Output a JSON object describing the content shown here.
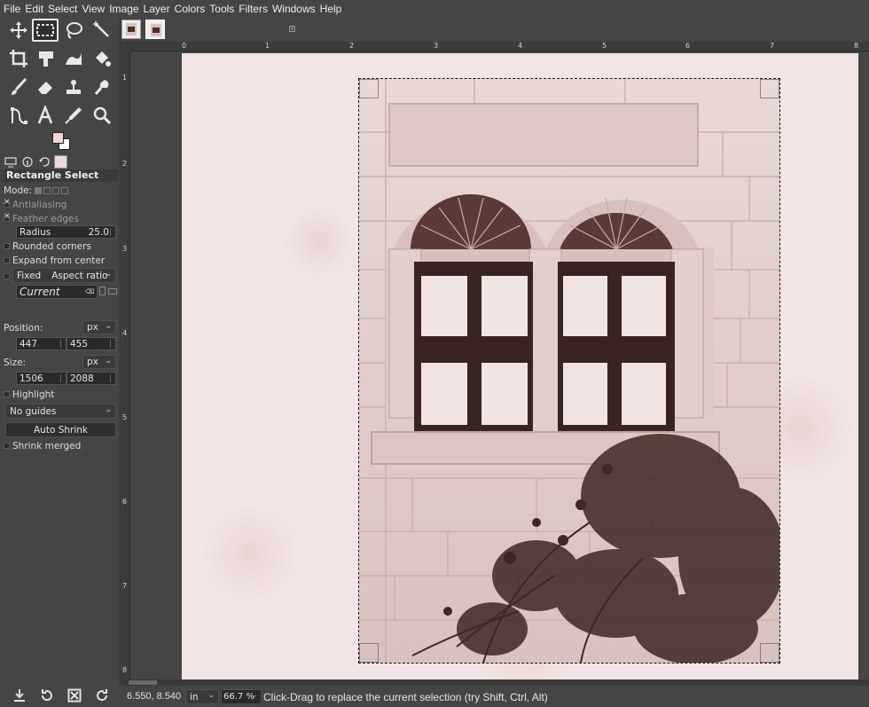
{
  "menubar": [
    "File",
    "Edit",
    "Select",
    "View",
    "Image",
    "Layer",
    "Colors",
    "Tools",
    "Filters",
    "Windows",
    "Help"
  ],
  "toolbox": {
    "tools": [
      "move-tool",
      "rectangle-select-tool",
      "free-select-tool",
      "fuzzy-select-tool",
      "crop-tool",
      "unified-transform-tool",
      "warp-transform-tool",
      "bucket-fill-tool",
      "paintbrush-tool",
      "eraser-tool",
      "clone-tool",
      "smudge-tool",
      "paths-tool",
      "text-tool",
      "color-picker-tool",
      "zoom-tool"
    ],
    "active": "rectangle-select-tool",
    "fg_color": "#f2d7d3",
    "bg_color": "#ffffff"
  },
  "tool_options": {
    "title": "Rectangle Select",
    "mode_label": "Mode:",
    "antialiasing": "Antialiasing",
    "feather_edges": "Feather edges",
    "radius_label": "Radius",
    "radius_value": "25.0",
    "rounded_corners": "Rounded corners",
    "expand_from_center": "Expand from center",
    "fixed_label": "Fixed",
    "fixed_mode": "Aspect ratio",
    "fixed_value": "Current",
    "position_label": "Position:",
    "position_unit": "px",
    "position_x": "447",
    "position_y": "455",
    "size_label": "Size:",
    "size_unit": "px",
    "size_w": "1506",
    "size_h": "2088",
    "highlight": "Highlight",
    "guides": "No guides",
    "auto_shrink": "Auto Shrink",
    "shrink_merged": "Shrink merged"
  },
  "ruler_top": [
    "0",
    "1",
    "2",
    "3",
    "4",
    "5",
    "6",
    "7",
    "8"
  ],
  "ruler_left": [
    "1",
    "2",
    "3",
    "4",
    "5",
    "6",
    "7",
    "8"
  ],
  "status": {
    "coords": "6.550, 8.540",
    "unit": "in",
    "zoom": "66.7 %",
    "message": "Click-Drag to replace the current selection (try Shift, Ctrl, Alt)"
  }
}
